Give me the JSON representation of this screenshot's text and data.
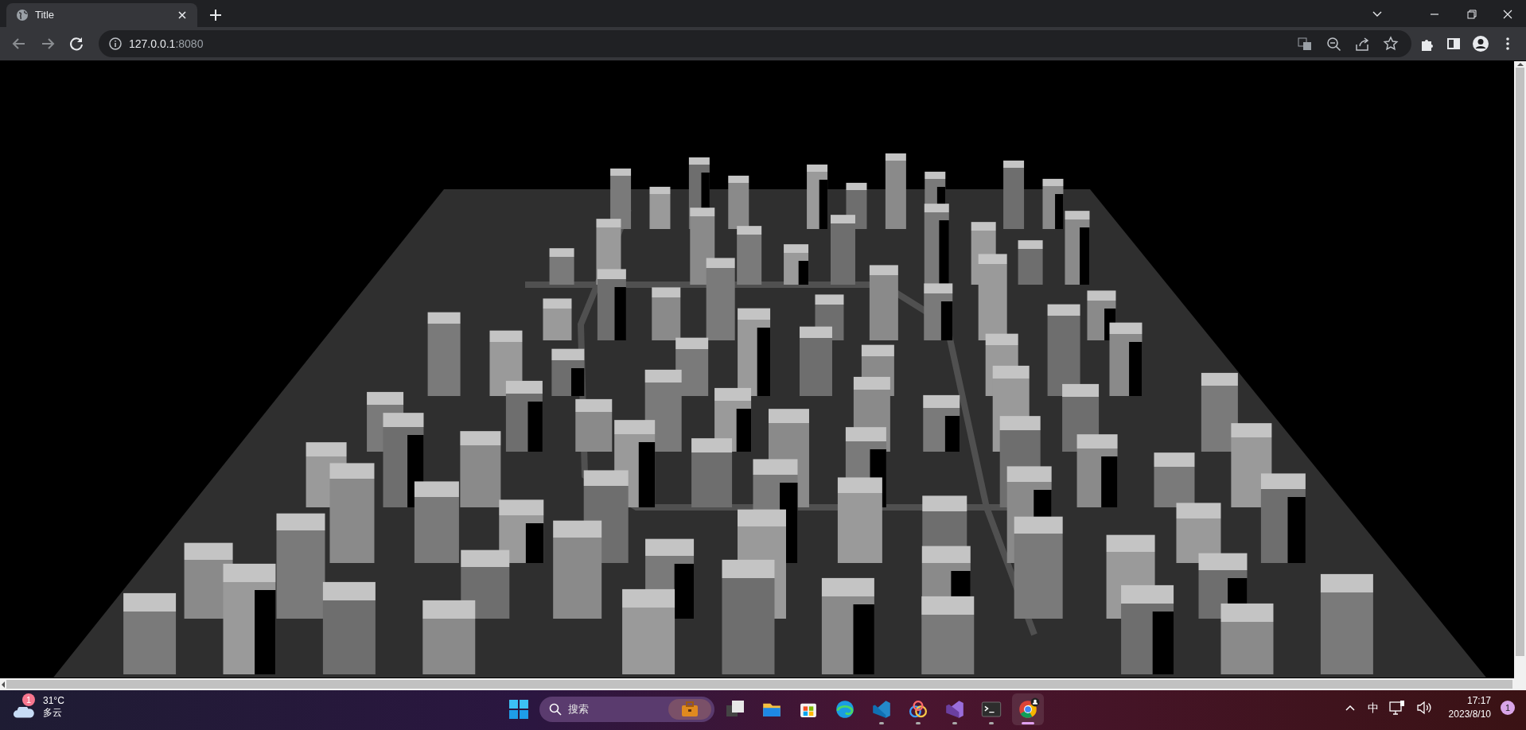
{
  "tabs": [
    {
      "title": "Title",
      "selected": true
    }
  ],
  "address_bar": {
    "host": "127.0.0.1",
    "port": ":8080"
  },
  "weather": {
    "badge": "1",
    "temperature": "31°C",
    "condition": "多云"
  },
  "taskbar": {
    "search_placeholder": "搜索",
    "apps": [
      {
        "kind": "explorer",
        "running": false,
        "selected": false
      },
      {
        "kind": "store",
        "running": false,
        "selected": false
      },
      {
        "kind": "edge",
        "running": false,
        "selected": false
      },
      {
        "kind": "vscode",
        "running": true,
        "selected": false
      },
      {
        "kind": "rings",
        "running": true,
        "selected": false
      },
      {
        "kind": "studio",
        "running": true,
        "selected": false
      },
      {
        "kind": "terminal",
        "running": true,
        "selected": false
      },
      {
        "kind": "chrome",
        "running": true,
        "selected": true
      }
    ]
  },
  "tray": {
    "ime": "中",
    "time": "17:17",
    "date": "2023/8/10",
    "notification_count": "1"
  }
}
